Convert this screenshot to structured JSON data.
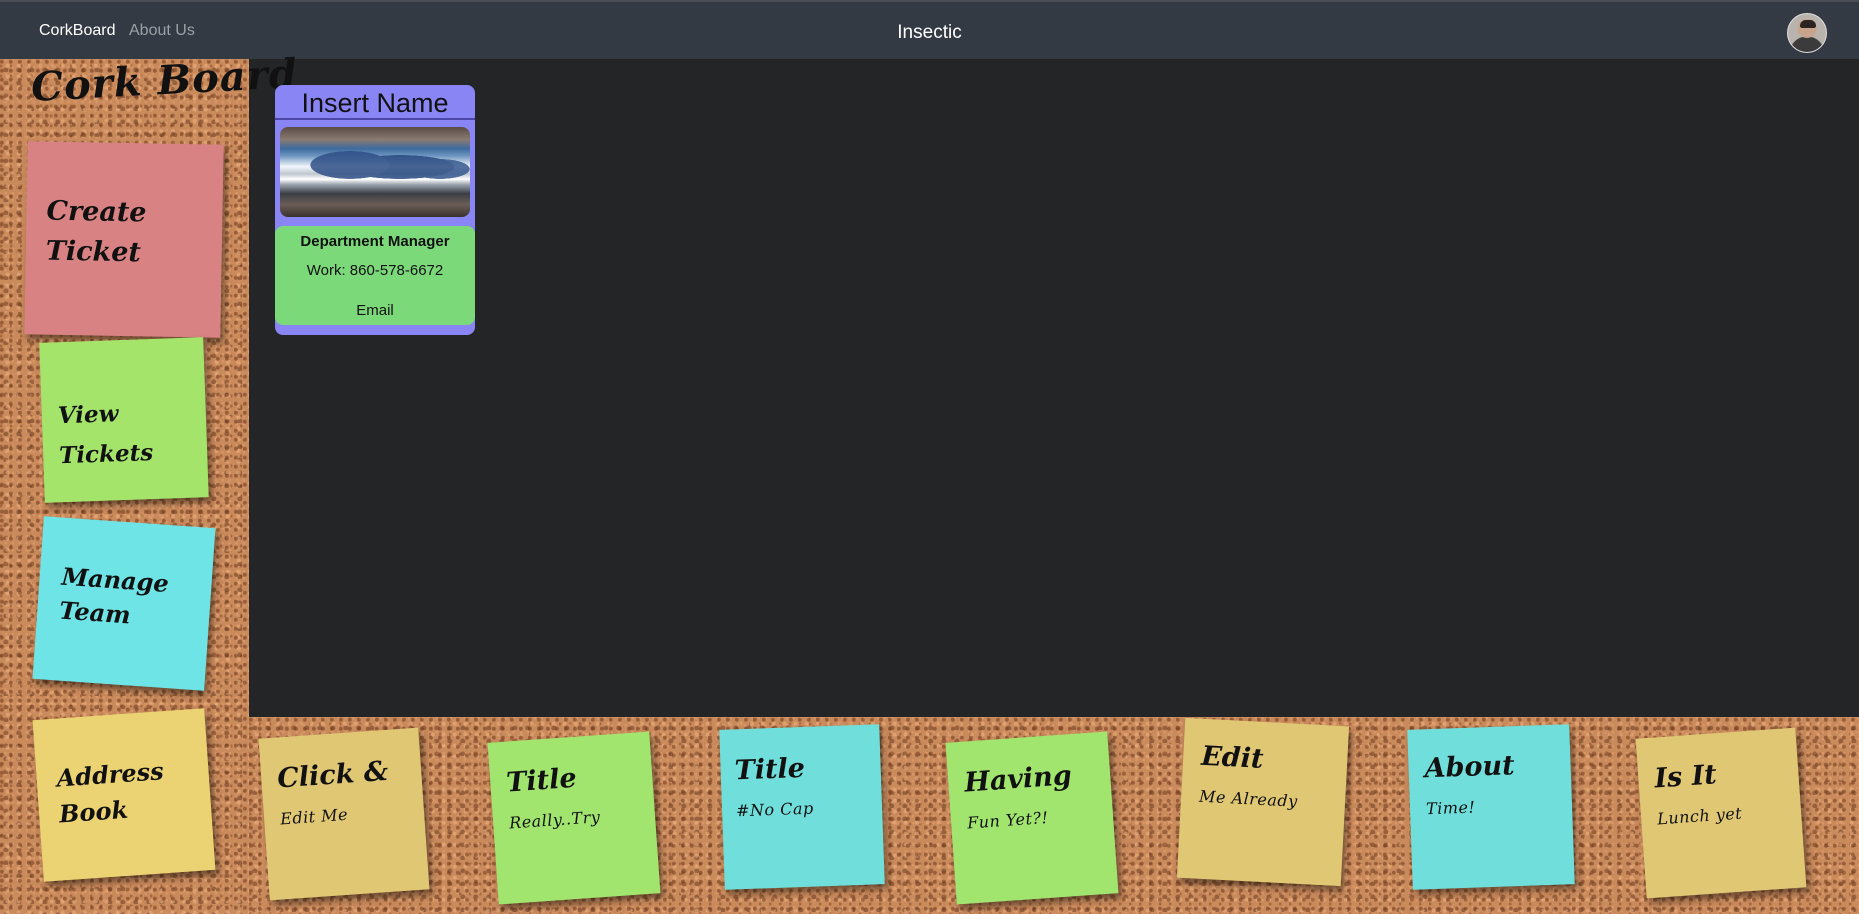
{
  "nav": {
    "links": [
      {
        "label": "CorkBoard"
      },
      {
        "label": "About Us"
      }
    ],
    "brand": "Insectic"
  },
  "sidebar": {
    "title": "Cork Board",
    "notes": [
      {
        "label": "Create",
        "label2": "Ticket",
        "color": "#d88284"
      },
      {
        "label": "View Tickets",
        "color": "#a5e46a"
      },
      {
        "label": "Manage",
        "label2": "Team",
        "color": "#6ee4e6"
      },
      {
        "label": "Address",
        "label2": "Book",
        "color": "#ebd272"
      }
    ]
  },
  "card": {
    "name": "Insert Name",
    "title": "Department Manager",
    "phone": "Work: 860-578-6672",
    "email_label": "Email",
    "colors": {
      "frame": "#8a85f4",
      "info": "#7bd97a"
    }
  },
  "bottom_notes": [
    {
      "title": "Click &",
      "text": "Edit Me",
      "color": "#e0c774"
    },
    {
      "title": "Title",
      "text": "Really..Try",
      "color": "#a1e56e"
    },
    {
      "title": "Title",
      "text": "#No Cap",
      "color": "#70dfdb"
    },
    {
      "title": "Having",
      "text": "Fun Yet?!",
      "color": "#a1e56e"
    },
    {
      "title": "Edit",
      "text": "Me Already",
      "color": "#e0c774"
    },
    {
      "title": "About",
      "text": "Time!",
      "color": "#70dfdb"
    },
    {
      "title": "Is It",
      "text": "Lunch yet",
      "color": "#e0c774"
    }
  ]
}
